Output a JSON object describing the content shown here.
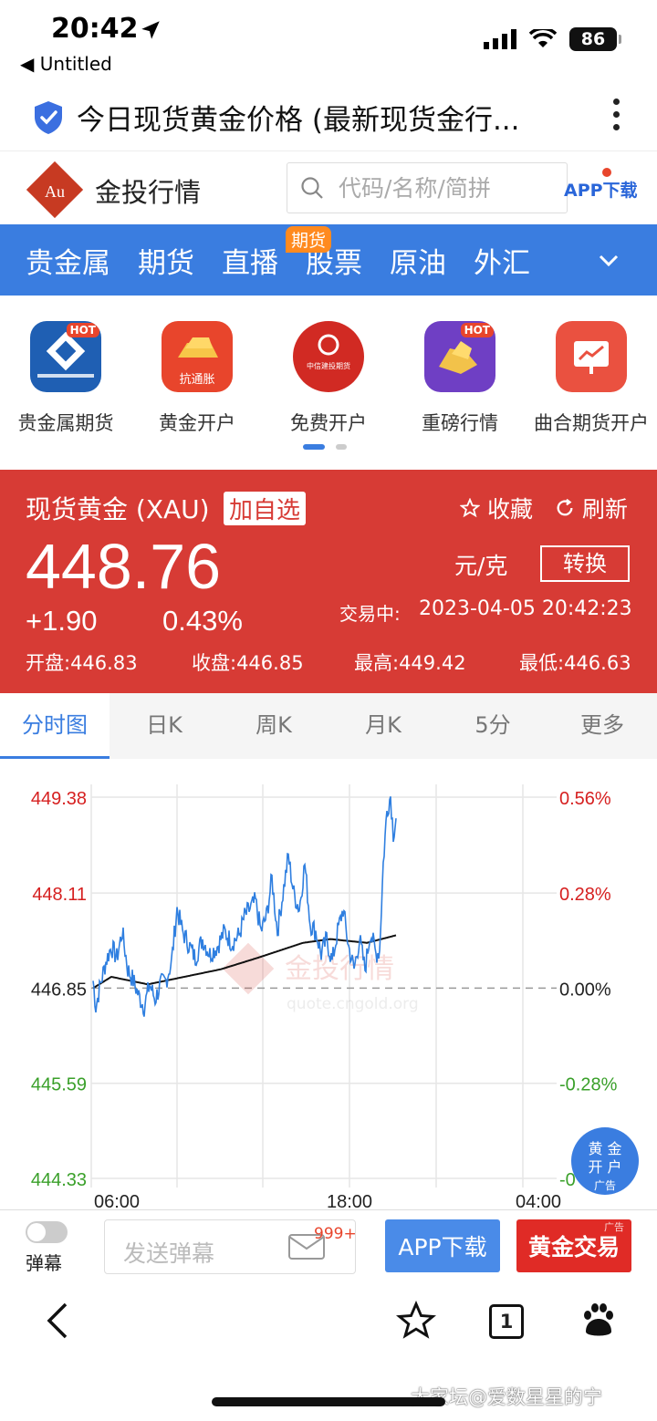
{
  "status": {
    "time": "20:42",
    "back_app": "Untitled",
    "battery": "86"
  },
  "browser": {
    "title": "今日现货黄金价格 (最新现货金行..."
  },
  "site": {
    "name": "金投行情",
    "logo_text": "Au",
    "search_placeholder": "代码/名称/简拼",
    "app_download": "APP下载"
  },
  "nav": {
    "items": [
      "贵金属",
      "期货",
      "直播",
      "股票",
      "原油",
      "外汇"
    ],
    "badge": "期货"
  },
  "ads": [
    {
      "label": "贵金属期货",
      "tag": "HOT",
      "color": "#1f5fb3"
    },
    {
      "label": "黄金开户",
      "tag": "",
      "color": "#e8452c",
      "sub": "抗通胀"
    },
    {
      "label": "免费开户",
      "tag": "",
      "color": "#d12a23",
      "sub": "中信建投期货"
    },
    {
      "label": "重磅行情",
      "tag": "HOT",
      "color": "#6f3fc4"
    },
    {
      "label": "曲合期货开户",
      "tag": "",
      "color": "#ea5140"
    }
  ],
  "quote": {
    "name": "现货黄金 (XAU)",
    "add_watch": "加自选",
    "favorite": "收藏",
    "refresh": "刷新",
    "price": "448.76",
    "unit": "元/克",
    "convert": "转换",
    "change": "+1.90",
    "change_pct": "0.43%",
    "status": "交易中:",
    "datetime": "2023-04-05 20:42:23",
    "open": "开盘:446.83",
    "close": "收盘:446.85",
    "high": "最高:449.42",
    "low": "最低:446.63"
  },
  "tabs": [
    "分时图",
    "日K",
    "周K",
    "月K",
    "5分",
    "更多"
  ],
  "chart_data": {
    "type": "line",
    "y_left_ticks": [
      "449.38",
      "448.11",
      "446.85",
      "445.59",
      "444.33"
    ],
    "y_right_ticks": [
      "0.56%",
      "0.28%",
      "0.00%",
      "-0.28%",
      "-0"
    ],
    "x_ticks": [
      "06:00",
      "18:00",
      "04:00"
    ],
    "ylim": [
      444.33,
      449.38
    ],
    "baseline": 446.85,
    "grid": true,
    "watermark_name": "金投行情",
    "watermark_url": "quote.cngold.org",
    "colors": {
      "price": "#2f7fe0",
      "avg": "#111111",
      "up": "#d62020",
      "down": "#3aa02a"
    },
    "price_anchors": [
      [
        0,
        446.95
      ],
      [
        3,
        446.6
      ],
      [
        8,
        446.9
      ],
      [
        14,
        447.2
      ],
      [
        20,
        447.4
      ],
      [
        26,
        447.25
      ],
      [
        32,
        447.6
      ],
      [
        38,
        447.1
      ],
      [
        44,
        446.95
      ],
      [
        50,
        446.75
      ],
      [
        56,
        446.6
      ],
      [
        62,
        446.9
      ],
      [
        68,
        446.7
      ],
      [
        74,
        446.9
      ],
      [
        80,
        446.95
      ],
      [
        86,
        447.2
      ],
      [
        92,
        447.9
      ],
      [
        98,
        447.6
      ],
      [
        104,
        447.45
      ],
      [
        112,
        447.25
      ],
      [
        120,
        447.5
      ],
      [
        128,
        447.3
      ],
      [
        136,
        447.4
      ],
      [
        144,
        447.6
      ],
      [
        152,
        447.45
      ],
      [
        160,
        447.55
      ],
      [
        166,
        447.8
      ],
      [
        172,
        447.9
      ],
      [
        178,
        448.0
      ],
      [
        184,
        447.6
      ],
      [
        190,
        447.8
      ],
      [
        196,
        448.3
      ],
      [
        202,
        447.6
      ],
      [
        208,
        448.1
      ],
      [
        214,
        448.6
      ],
      [
        220,
        448.1
      ],
      [
        226,
        447.9
      ],
      [
        232,
        448.5
      ],
      [
        238,
        447.7
      ],
      [
        244,
        447.6
      ],
      [
        250,
        447.3
      ],
      [
        256,
        447.5
      ],
      [
        262,
        447.2
      ],
      [
        268,
        447.6
      ],
      [
        274,
        447.9
      ],
      [
        280,
        447.4
      ],
      [
        286,
        447.1
      ],
      [
        292,
        447.5
      ],
      [
        298,
        447.1
      ],
      [
        304,
        447.6
      ],
      [
        310,
        447.3
      ],
      [
        314,
        447.35
      ],
      [
        318,
        448.5
      ],
      [
        322,
        449.2
      ],
      [
        326,
        449.4
      ],
      [
        329,
        448.9
      ],
      [
        332,
        449.1
      ]
    ],
    "avg_anchors": [
      [
        0,
        446.85
      ],
      [
        20,
        447.0
      ],
      [
        60,
        446.9
      ],
      [
        100,
        447.0
      ],
      [
        140,
        447.1
      ],
      [
        180,
        447.25
      ],
      [
        230,
        447.45
      ],
      [
        260,
        447.5
      ],
      [
        300,
        447.45
      ],
      [
        332,
        447.55
      ]
    ]
  },
  "floating_ad": {
    "line1": "黄 金",
    "line2": "开 户",
    "tag": "广告"
  },
  "actionbar": {
    "toggle_label": "弹幕",
    "danmu_placeholder": "发送弹幕",
    "msg_count": "999+",
    "app_button": "APP下载",
    "gold_button": "黄金交易",
    "gold_tag": "广告"
  },
  "toolbar": {
    "tabs_count": "1",
    "watermark": "大家坛@爱数星星的宁"
  }
}
